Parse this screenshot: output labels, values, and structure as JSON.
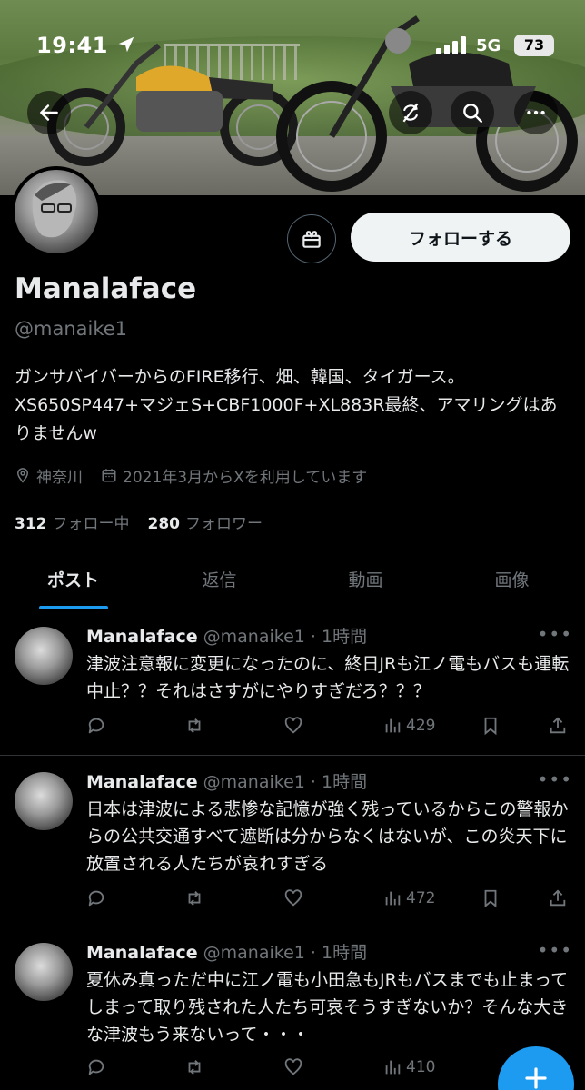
{
  "status_bar": {
    "time": "19:41",
    "network": "5G",
    "battery": "73"
  },
  "header": {
    "back_icon": "arrow-left-icon",
    "refresh_icon": "refresh-slash-icon",
    "search_icon": "search-icon",
    "more_icon": "more-horizontal-icon"
  },
  "profile": {
    "name": "Manalaface",
    "handle": "@manaike1",
    "bio": "ガンサバイバーからのFIRE移行、畑、韓国、タイガース。XS650SP447+マジェS+CBF1000F+XL883R最終、アマリングはありませんw",
    "location": "神奈川",
    "joined": "2021年3月からXを利用しています",
    "following_count": "312",
    "following_label": "フォロー中",
    "followers_count": "280",
    "followers_label": "フォロワー",
    "follow_button": "フォローする"
  },
  "tabs": [
    {
      "label": "ポスト",
      "active": true
    },
    {
      "label": "返信",
      "active": false
    },
    {
      "label": "動画",
      "active": false
    },
    {
      "label": "画像",
      "active": false
    }
  ],
  "posts": [
    {
      "name": "Manalaface",
      "meta": "@manaike1 · 1時間",
      "text": "津波注意報に変更になったのに、終日JRも江ノ電もバスも運転中止？？それはさすがにやりすぎだろ？？？",
      "views": "429"
    },
    {
      "name": "Manalaface",
      "meta": "@manaike1 · 1時間",
      "text": "日本は津波による悲惨な記憶が強く残っているからこの警報からの公共交通すべて遮断は分からなくはないが、この炎天下に放置される人たちが哀れすぎる",
      "views": "472"
    },
    {
      "name": "Manalaface",
      "meta": "@manaike1 · 1時間",
      "text": "夏休み真っただ中に江ノ電も小田急もJRもバスまでも止まってしまって取り残された人たち可哀そうすぎないか？そんな大きな津波もう来ないって・・・",
      "views": "410"
    }
  ],
  "colors": {
    "accent": "#1d9bf0",
    "background": "#000000",
    "muted": "#71767b",
    "text": "#e7e9ea"
  }
}
